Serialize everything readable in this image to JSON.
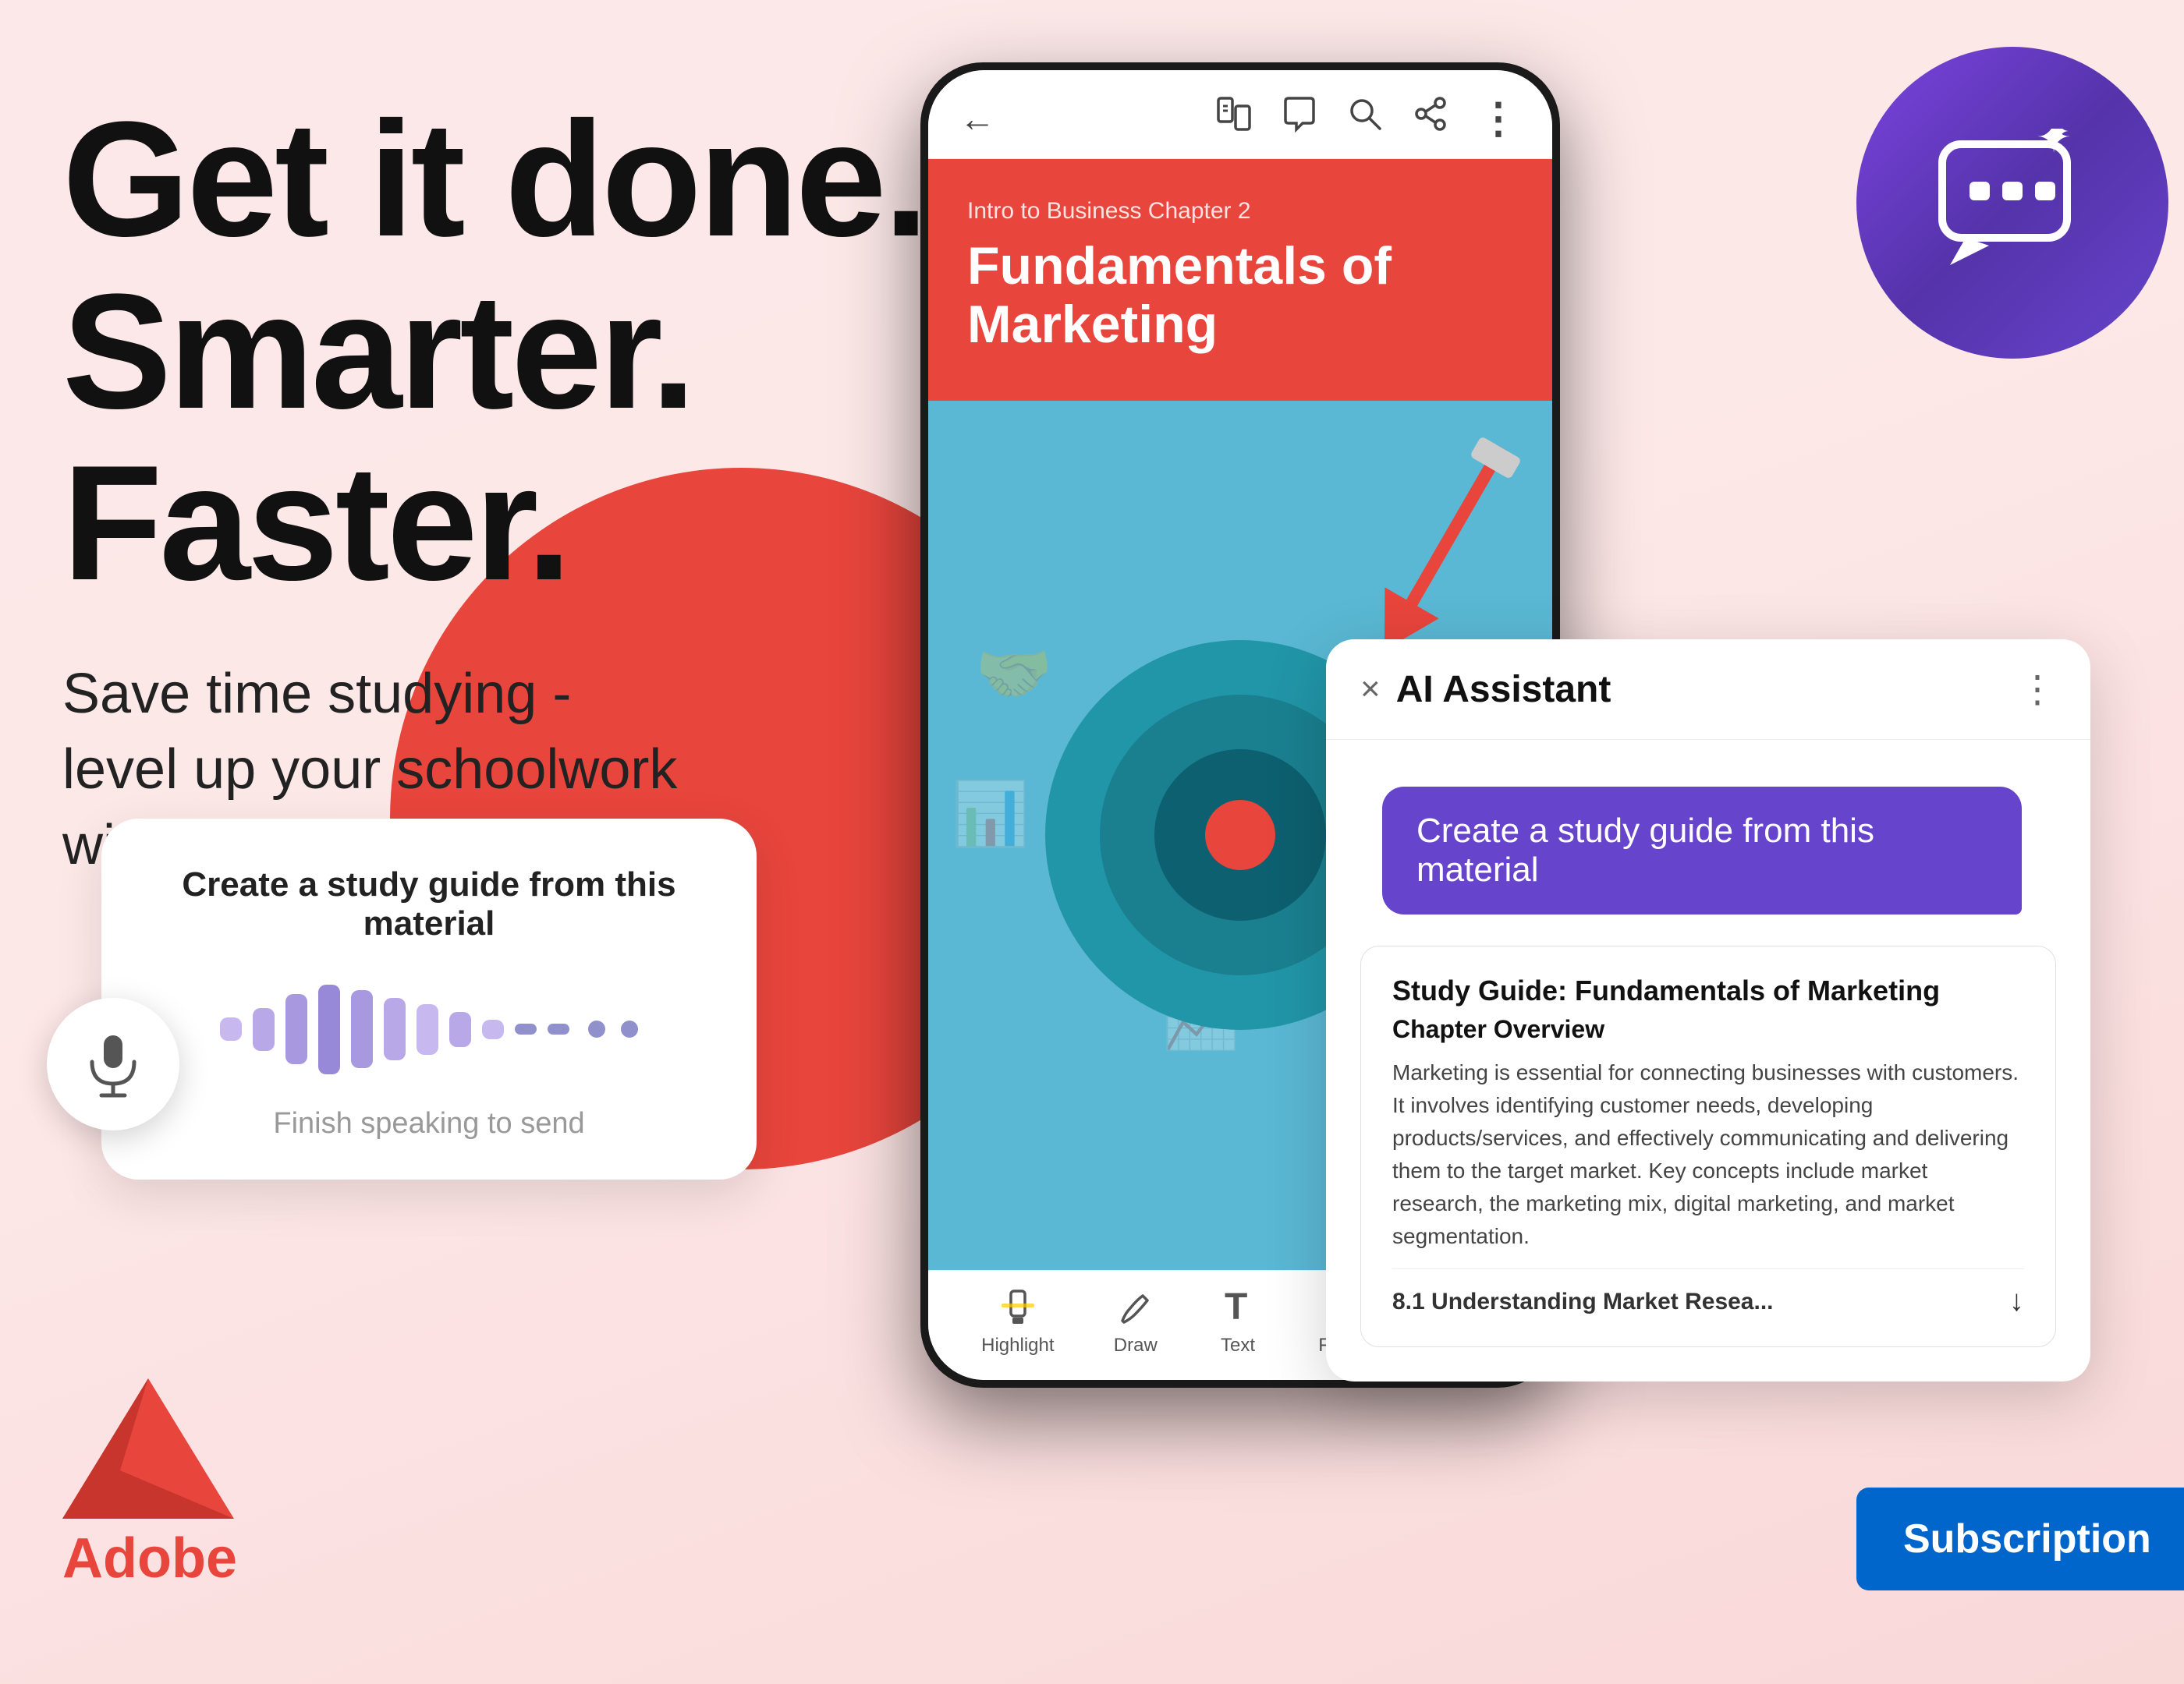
{
  "background": {
    "color": "#fce8e8"
  },
  "headline": {
    "line1": "Get it done.",
    "line2": "Smarter. Faster."
  },
  "subtitle": {
    "line1": "Save time studying -",
    "line2": "level up your schoolwork",
    "line3": "with AI Assistant"
  },
  "adobe": {
    "label": "Adobe"
  },
  "voice_card": {
    "title": "Create a study guide from this material",
    "hint": "Finish speaking to send"
  },
  "phone": {
    "chapter": "Intro to Business Chapter 2",
    "book_title": "Fundamentals of Marketing",
    "topbar_icons": [
      "←",
      "⊕≡",
      "⊙",
      "🔍",
      "⊕",
      "⋮"
    ]
  },
  "ai_panel": {
    "title": "AI Assistant",
    "close_label": "×",
    "more_label": "⋮",
    "user_query": "Create a study guide from this material",
    "study_guide": {
      "header": "Study Guide: Fundamentals of Marketing",
      "chapter_overview_label": "Chapter Overview",
      "body_text": "Marketing is essential for connecting businesses with customers. It involves identifying customer needs, developing products/services, and effectively communicating and delivering them to the target market. Key concepts include market research, the marketing mix, digital marketing, and market segmentation.",
      "section_link": "8.1 Understanding Market Resea..."
    }
  },
  "ai_badge": {
    "label": "AI Chat"
  },
  "subscription_btn": {
    "label": "Subscription"
  },
  "bottombar": {
    "tools": [
      {
        "icon": "💬+",
        "label": "Highlight"
      },
      {
        "icon": "✏",
        "label": "Draw"
      },
      {
        "icon": "T",
        "label": "Text"
      },
      {
        "icon": "⬡",
        "label": "Fill & Sim"
      },
      {
        "icon": "⊞",
        "label": ""
      }
    ]
  },
  "waveform": {
    "bars": [
      {
        "height": 30,
        "color": "#c8b8f0"
      },
      {
        "height": 55,
        "color": "#b8a8e8"
      },
      {
        "height": 90,
        "color": "#a898e0"
      },
      {
        "height": 115,
        "color": "#9888d8"
      },
      {
        "height": 100,
        "color": "#a898e0"
      },
      {
        "height": 80,
        "color": "#b8a8e8"
      },
      {
        "height": 65,
        "color": "#c8b8f0"
      },
      {
        "height": 45,
        "color": "#b8a8e8"
      },
      {
        "height": 25,
        "color": "#c8b8f0"
      },
      {
        "height": 14,
        "color": "#9090cc"
      },
      {
        "height": 14,
        "color": "#9090cc"
      }
    ]
  }
}
